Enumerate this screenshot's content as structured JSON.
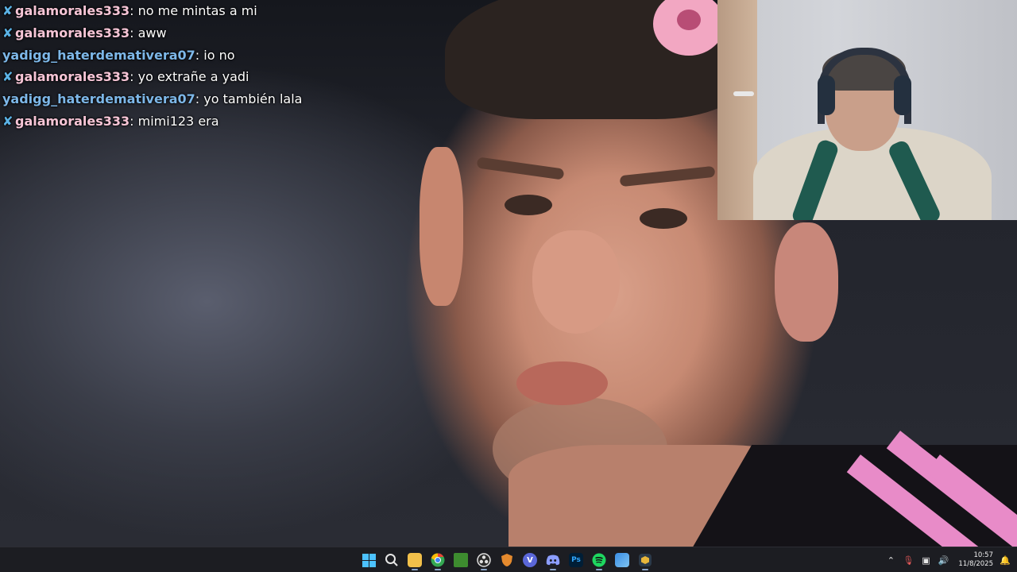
{
  "chat": {
    "messages": [
      {
        "badge": true,
        "user": "galamorales333",
        "user_color": "#f6c5d6",
        "text": "no me mintas a mi"
      },
      {
        "badge": true,
        "user": "galamorales333",
        "user_color": "#f6c5d6",
        "text": "aww"
      },
      {
        "badge": false,
        "user": "yadigg_haterdemativera07",
        "user_color": "#7db7e8",
        "text": "io no"
      },
      {
        "badge": true,
        "user": "galamorales333",
        "user_color": "#f6c5d6",
        "text": "yo extrañe a yadi"
      },
      {
        "badge": false,
        "user": "yadigg_haterdemativera07",
        "user_color": "#7db7e8",
        "text": "yo también lala"
      },
      {
        "badge": true,
        "user": "galamorales333",
        "user_color": "#f6c5d6",
        "text": "mimi123 era"
      }
    ]
  },
  "taskbar": {
    "apps": [
      {
        "name": "start-icon",
        "label": ""
      },
      {
        "name": "search-icon",
        "label": ""
      },
      {
        "name": "file-explorer-icon",
        "label": ""
      },
      {
        "name": "chrome-icon",
        "label": ""
      },
      {
        "name": "minecraft-icon",
        "label": ""
      },
      {
        "name": "obs-icon",
        "label": ""
      },
      {
        "name": "shield-app-icon",
        "label": ""
      },
      {
        "name": "vpn-icon",
        "label": "V"
      },
      {
        "name": "discord-icon",
        "label": ""
      },
      {
        "name": "photoshop-icon",
        "label": "Ps"
      },
      {
        "name": "spotify-icon",
        "label": ""
      },
      {
        "name": "photos-icon",
        "label": ""
      },
      {
        "name": "game-app-icon",
        "label": ""
      }
    ],
    "clock_time": "10:57",
    "clock_date": "11/8/2025"
  },
  "colors": {
    "chat_badge": "#5bb3e6",
    "taskbar_bg": "#1c1d22",
    "windows_blue": "#4cc2ff",
    "shirt_pink": "#e88bc8"
  }
}
